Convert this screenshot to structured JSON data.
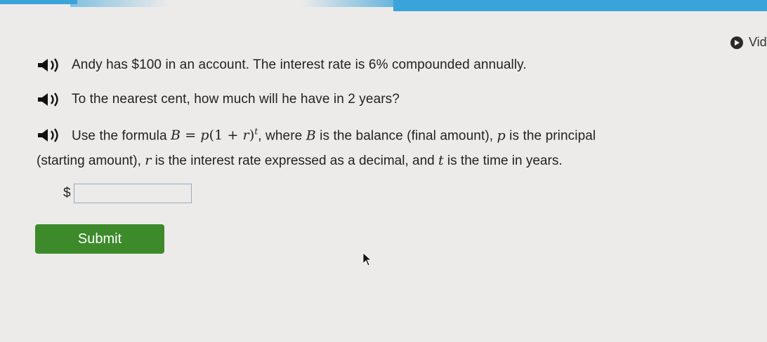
{
  "header": {
    "video_label": "Vide"
  },
  "problem": {
    "line1": "Andy has $100 in an account. The interest rate is 6% compounded annually.",
    "line2": "To the nearest cent, how much will he have in 2 years?",
    "line3_prefix": "Use the formula",
    "formula_lhs": "B",
    "formula_eq": " = ",
    "formula_p": "p",
    "formula_paren": "(1 + ",
    "formula_r": "r",
    "formula_close": ")",
    "formula_exp": "t",
    "line3_mid": ", where",
    "var_B": "B",
    "line3_def_B": "is the balance (final amount),",
    "var_p": "p",
    "line3_def_p": "is the principal",
    "line4_start": "(starting amount),",
    "var_r": "r",
    "line4_def_r": "is the interest rate expressed as a decimal, and",
    "var_t": "t",
    "line4_def_t": "is the time in years."
  },
  "answer": {
    "currency": "$",
    "value": ""
  },
  "submit": {
    "label": "Submit"
  }
}
